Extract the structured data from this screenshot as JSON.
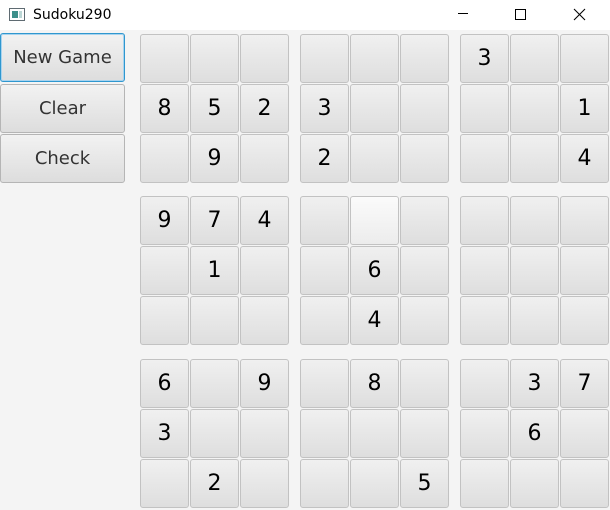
{
  "window": {
    "title": "Sudoku290",
    "controls": [
      "minimize",
      "maximize",
      "close"
    ]
  },
  "sidebar": {
    "buttons": [
      {
        "id": "new-game",
        "label": "New Game",
        "focused": true
      },
      {
        "id": "clear",
        "label": "Clear"
      },
      {
        "id": "check",
        "label": "Check"
      }
    ]
  },
  "board": {
    "rows": [
      [
        "",
        "",
        "",
        "",
        "",
        "",
        "3",
        "",
        ""
      ],
      [
        "8",
        "5",
        "2",
        "3",
        "",
        "",
        "",
        "",
        "1"
      ],
      [
        "",
        "9",
        "",
        "2",
        "",
        "",
        "",
        "",
        "4"
      ],
      [
        "9",
        "7",
        "4",
        "",
        "",
        "",
        "",
        "",
        ""
      ],
      [
        "",
        "1",
        "",
        "",
        "6",
        "",
        "",
        "",
        ""
      ],
      [
        "",
        "",
        "",
        "",
        "4",
        "",
        "",
        "",
        ""
      ],
      [
        "6",
        "",
        "9",
        "",
        "8",
        "",
        "",
        "3",
        "7"
      ],
      [
        "3",
        "",
        "",
        "",
        "",
        "",
        "",
        "6",
        ""
      ],
      [
        "",
        "2",
        "",
        "",
        "",
        "5",
        "",
        "",
        ""
      ]
    ]
  }
}
